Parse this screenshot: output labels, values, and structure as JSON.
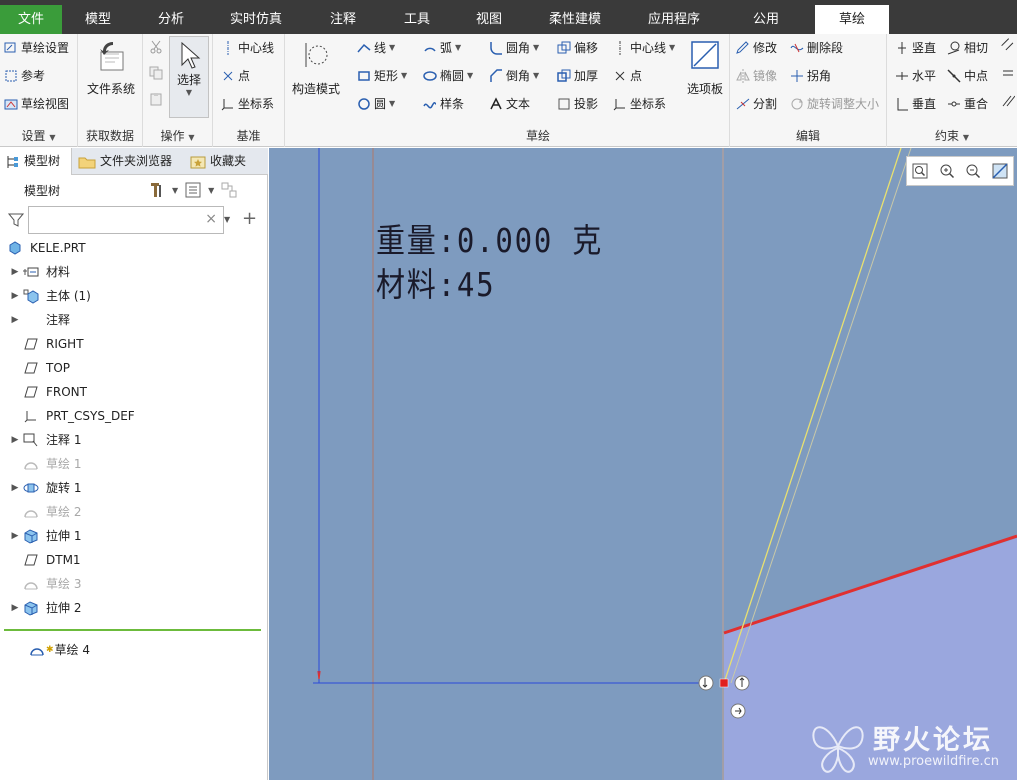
{
  "tabs": [
    "文件",
    "模型",
    "分析",
    "实时仿真",
    "注释",
    "工具",
    "视图",
    "柔性建模",
    "应用程序",
    "公用",
    "草绘"
  ],
  "ribbon": {
    "setup": {
      "items": [
        "草绘设置",
        "参考",
        "草绘视图"
      ],
      "title": "设置"
    },
    "getdata": {
      "label": "文件系统",
      "title": "获取数据"
    },
    "operations": {
      "label": "选择",
      "title": "操作"
    },
    "datum": {
      "items": [
        "中心线",
        "点",
        "坐标系"
      ],
      "title": "基准"
    },
    "construct": {
      "label": "构造模式"
    },
    "sketch": {
      "col1": [
        "线",
        "矩形",
        "圆"
      ],
      "col2": [
        "弧",
        "椭圆",
        "样条"
      ],
      "col3": [
        "圆角",
        "倒角",
        "文本"
      ],
      "col4": [
        "偏移",
        "加厚",
        "投影"
      ],
      "col5": [
        "中心线",
        "点",
        "坐标系"
      ],
      "palette": "选项板",
      "title": "草绘"
    },
    "edit": {
      "items": [
        "修改",
        "删除段",
        "镜像",
        "拐角",
        "分割",
        "旋转调整大小"
      ],
      "title": "编辑"
    },
    "constrain": {
      "items": [
        "竖直",
        "相切",
        "水平",
        "中点",
        "垂直",
        "重合"
      ],
      "title": "约束"
    }
  },
  "sidebar": {
    "tabs": [
      "模型树",
      "文件夹浏览器",
      "收藏夹"
    ],
    "tree_title": "模型树",
    "filter_placeholder": "",
    "items": [
      {
        "label": "KELE.PRT",
        "expand": false,
        "dim": false,
        "icon": "part-icon"
      },
      {
        "label": "材料",
        "expand": true,
        "dim": false,
        "icon": "material-icon"
      },
      {
        "label": "主体 (1)",
        "expand": true,
        "dim": false,
        "icon": "body-icon"
      },
      {
        "label": "注释",
        "expand": true,
        "dim": false,
        "icon": "none"
      },
      {
        "label": "RIGHT",
        "expand": false,
        "dim": false,
        "icon": "plane-icon"
      },
      {
        "label": "TOP",
        "expand": false,
        "dim": false,
        "icon": "plane-icon"
      },
      {
        "label": "FRONT",
        "expand": false,
        "dim": false,
        "icon": "plane-icon"
      },
      {
        "label": "PRT_CSYS_DEF",
        "expand": false,
        "dim": false,
        "icon": "csys-icon"
      },
      {
        "label": "注释 1",
        "expand": true,
        "dim": false,
        "icon": "annotation-icon"
      },
      {
        "label": "草绘 1",
        "expand": false,
        "dim": true,
        "icon": "sketch-icon"
      },
      {
        "label": "旋转 1",
        "expand": true,
        "dim": false,
        "icon": "revolve-icon"
      },
      {
        "label": "草绘 2",
        "expand": false,
        "dim": true,
        "icon": "sketch-icon"
      },
      {
        "label": "拉伸 1",
        "expand": true,
        "dim": false,
        "icon": "extrude-icon"
      },
      {
        "label": "DTM1",
        "expand": false,
        "dim": false,
        "icon": "plane-icon"
      },
      {
        "label": "草绘 3",
        "expand": false,
        "dim": true,
        "icon": "sketch-icon"
      },
      {
        "label": "拉伸 2",
        "expand": true,
        "dim": false,
        "icon": "extrude-icon"
      }
    ],
    "active_item": "草绘 4"
  },
  "canvas": {
    "note_weight": "重量:0.000 克",
    "note_material": "材料:45"
  },
  "watermark": {
    "title": "野火论坛",
    "url": "www.proewildfire.cn"
  },
  "colors": {
    "file_tab": "#3a9c3a",
    "canvas_bg": "#7e9bbf",
    "red_line": "#e03030",
    "yellow_line": "#e8e070",
    "blue_line": "#2a4ad8"
  }
}
